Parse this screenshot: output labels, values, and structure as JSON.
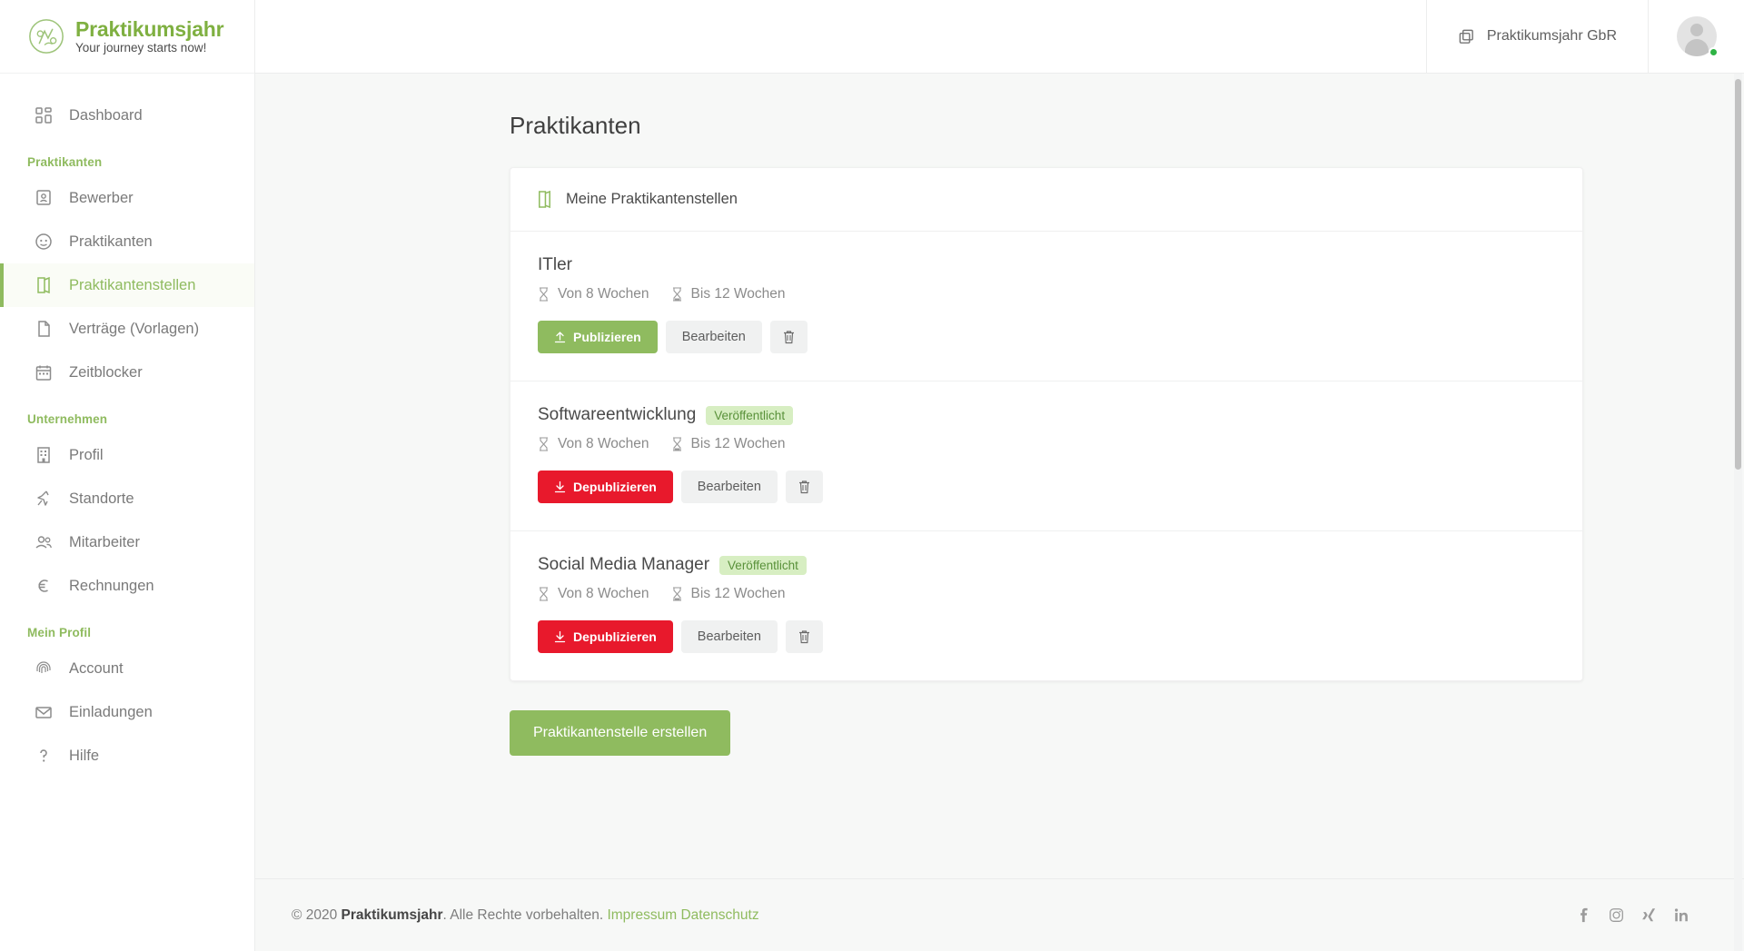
{
  "brand": {
    "name": "Praktikumsjahr",
    "tagline": "Your journey starts now!",
    "logo_icon": "circle-journey-logo",
    "accent_green": "#8fbb5f",
    "danger_red": "#e8192c"
  },
  "topbar": {
    "org_name": "Praktikumsjahr GbR",
    "org_icon": "copy-squares-icon",
    "avatar_icon": "user-avatar",
    "status": "online"
  },
  "sidebar": {
    "items": [
      {
        "label": "Dashboard",
        "icon": "dashboard-grid-icon",
        "active": false,
        "section": null
      },
      {
        "label": "Praktikanten",
        "icon": null,
        "active": false,
        "section": true
      },
      {
        "label": "Bewerber",
        "icon": "applicant-card-icon",
        "active": false,
        "section": null
      },
      {
        "label": "Praktikanten",
        "icon": "face-circle-icon",
        "active": false,
        "section": null
      },
      {
        "label": "Praktikantenstellen",
        "icon": "open-door-icon",
        "active": true,
        "section": null
      },
      {
        "label": "Verträge (Vorlagen)",
        "icon": "document-page-icon",
        "active": false,
        "section": null
      },
      {
        "label": "Zeitblocker",
        "icon": "calendar-icon",
        "active": false,
        "section": null
      },
      {
        "label": "Unternehmen",
        "icon": null,
        "active": false,
        "section": true
      },
      {
        "label": "Profil",
        "icon": "building-icon",
        "active": false,
        "section": null
      },
      {
        "label": "Standorte",
        "icon": "map-pin-icon",
        "active": false,
        "section": null
      },
      {
        "label": "Mitarbeiter",
        "icon": "people-icon",
        "active": false,
        "section": null
      },
      {
        "label": "Rechnungen",
        "icon": "euro-icon",
        "active": false,
        "section": null
      },
      {
        "label": "Mein Profil",
        "icon": null,
        "active": false,
        "section": true
      },
      {
        "label": "Account",
        "icon": "fingerprint-icon",
        "active": false,
        "section": null
      },
      {
        "label": "Einladungen",
        "icon": "envelope-icon",
        "active": false,
        "section": null
      },
      {
        "label": "Hilfe",
        "icon": "question-mark-icon",
        "active": false,
        "section": null
      }
    ]
  },
  "main": {
    "page_title": "Praktikanten",
    "card_header": "Meine Praktikantenstellen",
    "card_header_icon": "open-door-icon",
    "create_button": "Praktikantenstelle erstellen",
    "jobs": [
      {
        "title": "ITler",
        "badge": "",
        "from_label": "Von 8 Wochen",
        "to_label": "Bis 12 Wochen",
        "primary_action": "Publizieren",
        "primary_state": "publish",
        "edit_action": "Bearbeiten",
        "delete_icon": "trash-icon"
      },
      {
        "title": "Softwareentwicklung",
        "badge": "Veröffentlicht",
        "from_label": "Von 8 Wochen",
        "to_label": "Bis 12 Wochen",
        "primary_action": "Depublizieren",
        "primary_state": "unpublish",
        "edit_action": "Bearbeiten",
        "delete_icon": "trash-icon"
      },
      {
        "title": "Social Media Manager",
        "badge": "Veröffentlicht",
        "from_label": "Von 8 Wochen",
        "to_label": "Bis 12 Wochen",
        "primary_action": "Depublizieren",
        "primary_state": "unpublish",
        "edit_action": "Bearbeiten",
        "delete_icon": "trash-icon"
      }
    ]
  },
  "footer": {
    "copyright_pre": "© 2020 ",
    "copyright_brand": "Praktikumsjahr",
    "copyright_post": ". Alle Rechte vorbehalten. ",
    "link_impressum": "Impressum",
    "link_datenschutz": "Datenschutz",
    "social": [
      "facebook-icon",
      "instagram-icon",
      "xing-icon",
      "linkedin-icon"
    ]
  }
}
